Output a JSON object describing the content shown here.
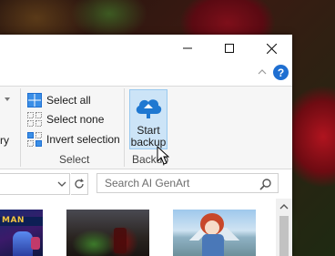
{
  "window": {
    "controls": {
      "minimize": "minimize",
      "maximize": "maximize",
      "close": "close"
    },
    "help_label": "?"
  },
  "ribbon": {
    "left_partial_label": "ry",
    "select_group": {
      "select_all": "Select all",
      "select_none": "Select none",
      "invert_selection": "Invert selection",
      "label": "Select"
    },
    "backup_group": {
      "start_backup_line1": "Start",
      "start_backup_line2": "backup",
      "label": "Backup"
    }
  },
  "address_bar": {
    "search_placeholder": "Search AI GenArt"
  },
  "thumbnails": [
    {
      "name": "thumbnail-1",
      "caption_partial": "MAN"
    },
    {
      "name": "thumbnail-2"
    },
    {
      "name": "thumbnail-3"
    }
  ],
  "colors": {
    "accent_blue": "#1f6fd1",
    "backup_highlight": "#cce4f7",
    "backup_border": "#99c9ef",
    "ribbon_bg": "#f6f6f6"
  },
  "icons": {
    "minimize": "minimize-icon",
    "maximize": "maximize-icon",
    "close": "close-icon",
    "help": "help-icon",
    "select_all": "select-all-icon",
    "select_none": "select-none-icon",
    "invert_selection": "invert-selection-icon",
    "start_backup": "cloud-upload-icon",
    "refresh": "refresh-icon",
    "search": "search-icon"
  }
}
